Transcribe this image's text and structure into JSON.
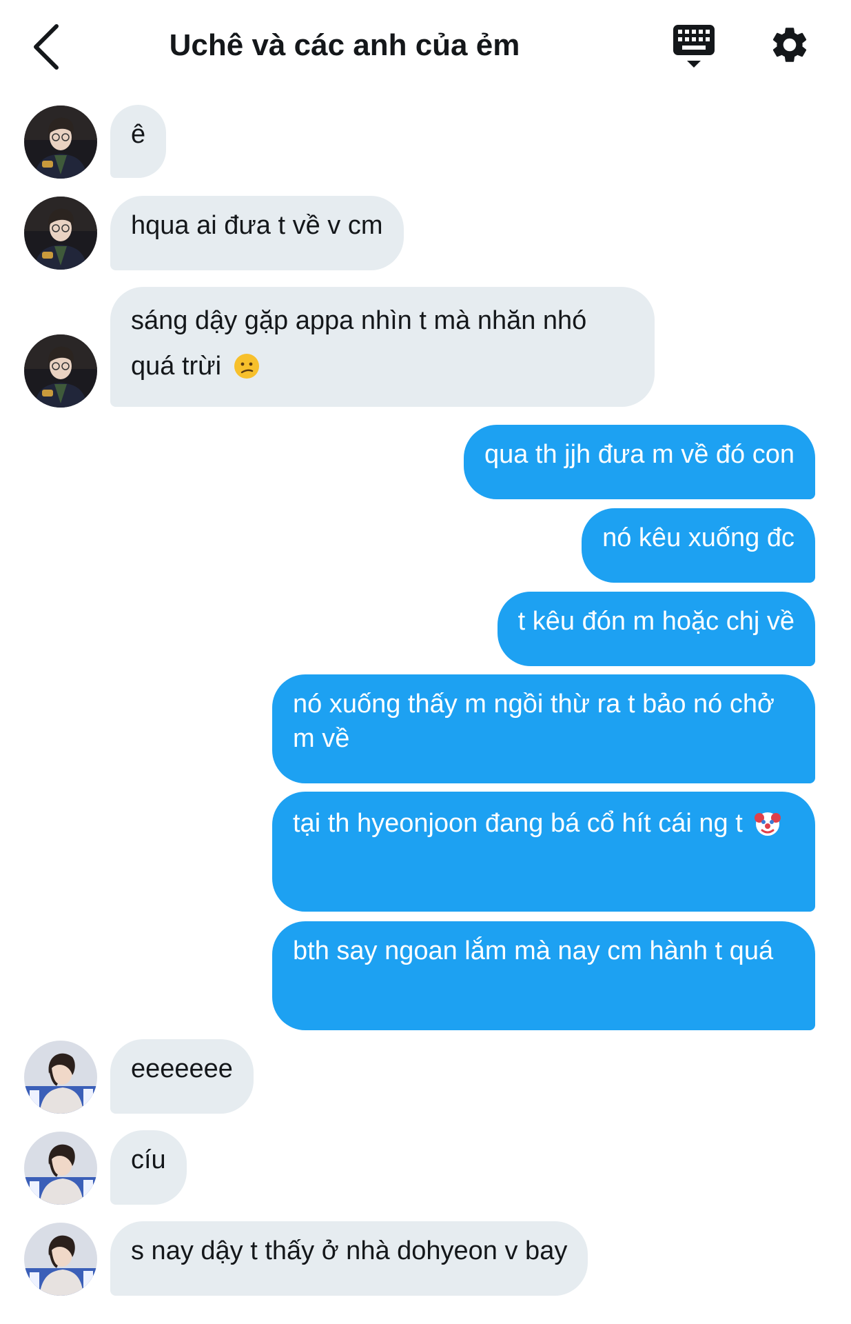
{
  "header": {
    "title": "Uchê và các anh của ẻm",
    "back_icon": "chevron-left-icon",
    "keyboard_icon": "keyboard-icon",
    "settings_icon": "gear-icon"
  },
  "colors": {
    "outgoing_bubble": "#1da1f2",
    "incoming_bubble": "#e6ecf0",
    "text_dark": "#14171a"
  },
  "messages": [
    {
      "sender": "them",
      "text": "ê"
    },
    {
      "sender": "them",
      "text": "hqua ai đưa t về v cm"
    },
    {
      "sender": "them",
      "text": "sáng dậy gặp appa nhìn t mà nhăn nhó quá trừi",
      "emoji": "confused-face-emoji"
    },
    {
      "sender": "me",
      "text": "qua th jjh đưa m về đó con"
    },
    {
      "sender": "me",
      "text": "nó kêu xuống đc"
    },
    {
      "sender": "me",
      "text": "t kêu đón m hoặc chj về"
    },
    {
      "sender": "me",
      "text": "nó xuống thấy m ngồi thừ ra t bảo nó chở m về"
    },
    {
      "sender": "me",
      "text": "tại th hyeonjoon đang bá cổ hít cái ng t",
      "emoji": "clown-face-emoji"
    },
    {
      "sender": "me",
      "text": "bth say ngoan lắm mà nay cm hành t quá"
    },
    {
      "sender": "them",
      "text": "eeeeeee"
    },
    {
      "sender": "them",
      "text": "cíu"
    },
    {
      "sender": "them",
      "text": "s nay dậy t thấy ở nhà dohyeon v bay"
    }
  ]
}
